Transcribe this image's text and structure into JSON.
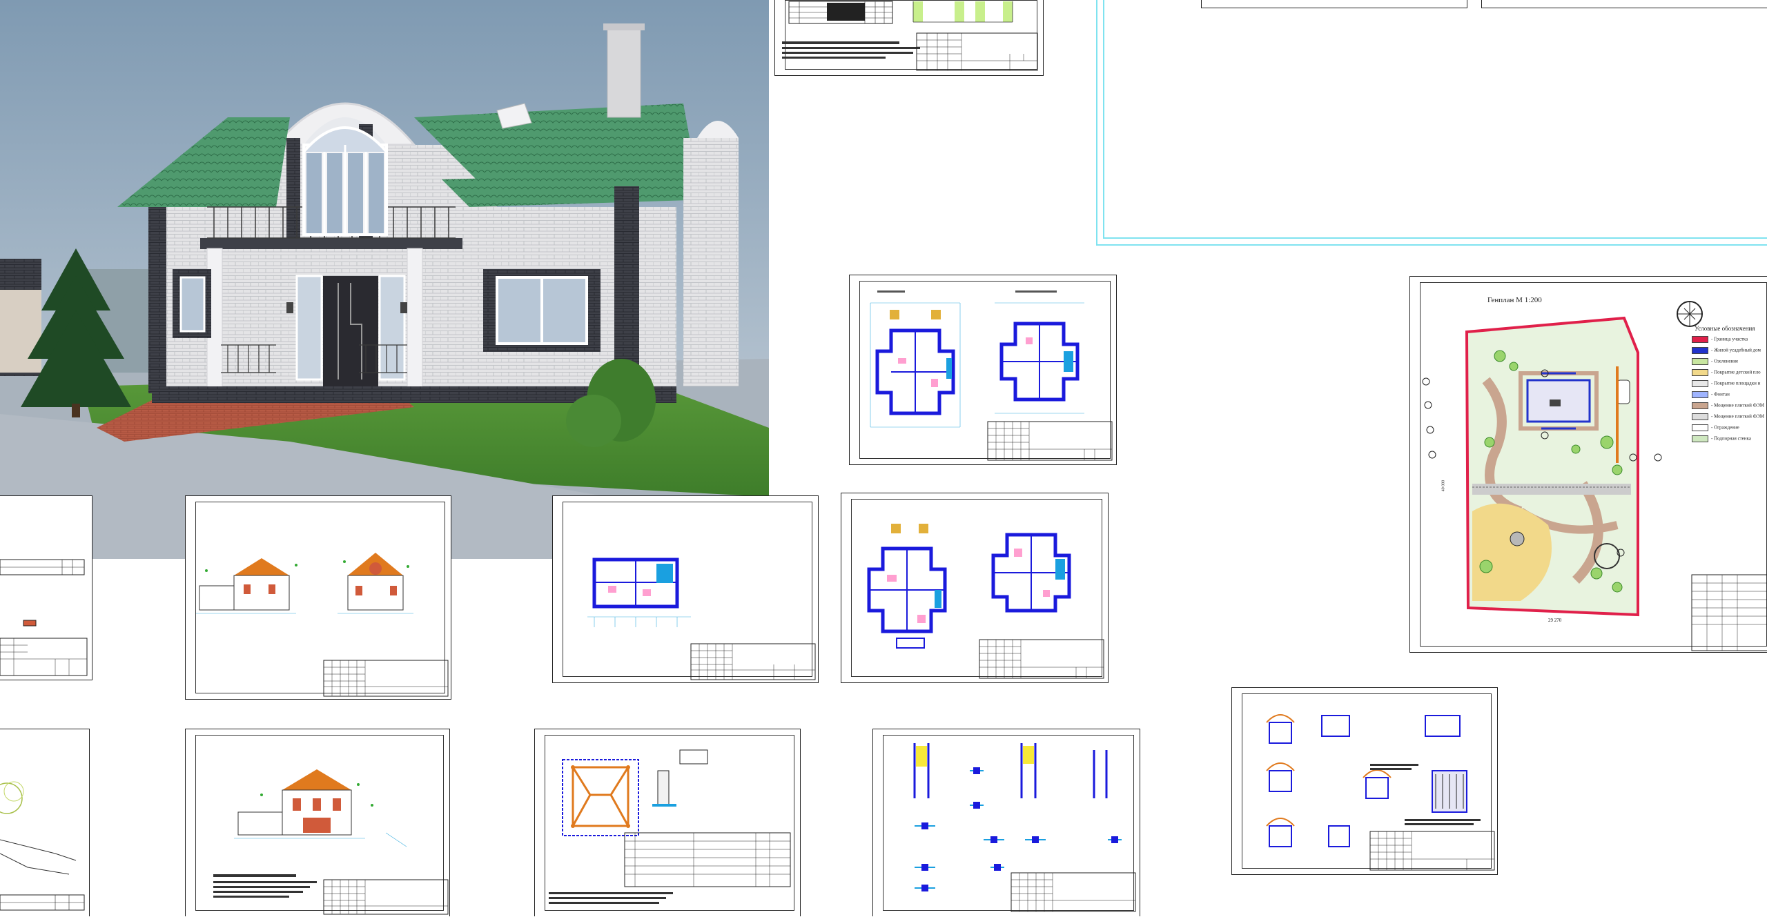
{
  "site_plan": {
    "title": "Генплан М 1:200",
    "legend_heading": "Условные обозначения",
    "legend_items": [
      {
        "label": "- Граница участка",
        "color": "#e0204a"
      },
      {
        "label": "- Жилой усадебный дом",
        "color": "#2233cc"
      },
      {
        "label": "- Озеленение",
        "color": "#c8e6a0"
      },
      {
        "label": "- Покрытие детской пло",
        "color": "#f2d98a"
      },
      {
        "label": "- Покрытие площадки и",
        "color": "#e8e8e8"
      },
      {
        "label": "- Фонтан",
        "color": "#9fb4ff"
      },
      {
        "label": "- Мощение плиткой ФЭМ",
        "color": "#c9a58f"
      },
      {
        "label": "- Мощение плиткой ФЭМ",
        "color": "#dddddd"
      },
      {
        "label": "- Ограждение",
        "color": "#ffffff"
      },
      {
        "label": "- Подпорная стенка",
        "color": "#cfe8c0"
      }
    ],
    "dim_bottom": "29 270",
    "dim_left": "40 000"
  },
  "colors": {
    "sheet_border": "#222222",
    "wall_blue": "#1a1adc",
    "cyan_frame": "#7fe3f0",
    "roof_green": "#4f9a6e",
    "roof_orange": "#e07a1e",
    "brick_red": "#b5533a",
    "boundary_red": "#e0204a"
  },
  "sheets_visible": [
    "rendering-3d",
    "notes-sheet-top",
    "floor-plans-1",
    "floor-plans-2",
    "basement-plan",
    "facades-1",
    "facade-2",
    "roof-plan",
    "sections-details",
    "site-plan",
    "details-sheet",
    "legend-sheet-left",
    "landscape-sheet-left",
    "cyan-frame-sheet"
  ]
}
